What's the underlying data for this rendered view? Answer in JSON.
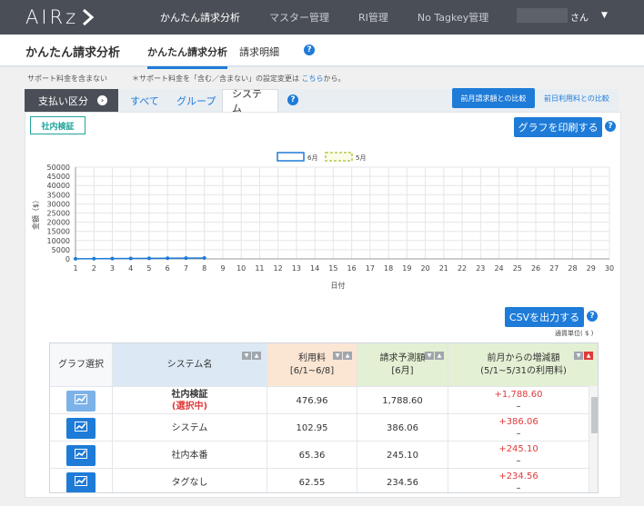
{
  "app": {
    "logo": "AIRz",
    "nav": [
      "かんたん請求分析",
      "マスター管理",
      "RI管理",
      "No Tagkey管理"
    ],
    "user_suffix": "さん",
    "user_caret": "▼"
  },
  "header": {
    "title": "かんたん請求分析",
    "tabs": [
      "かんたん請求分析",
      "請求明細"
    ],
    "help": "?"
  },
  "notes": {
    "support": "サポート料金を含まない",
    "support_setting_prefix": "＊サポート料金を「含む／含まない」の設定変更は",
    "support_setting_link": "こちら",
    "support_setting_suffix": "から。"
  },
  "tabs": {
    "payment_category": "支払い区分",
    "items": [
      "すべて",
      "グループ",
      "システム"
    ],
    "compare_prev_month": "前月請求額との比較",
    "compare_prev_day": "前日利用料との比較"
  },
  "selected_system": "社内検証",
  "print_button": "グラフを印刷する",
  "csv_button": "CSVを出力する",
  "unit_note": "通貨単位( $ )",
  "chart_data": {
    "type": "line",
    "legend": [
      "6月",
      "5月"
    ],
    "xlabel": "日付",
    "ylabel": "金額（$）",
    "x": [
      1,
      2,
      3,
      4,
      5,
      6,
      7,
      8
    ],
    "xticks": [
      1,
      2,
      3,
      4,
      5,
      6,
      7,
      8,
      9,
      10,
      11,
      12,
      13,
      14,
      15,
      16,
      17,
      18,
      19,
      20,
      21,
      22,
      23,
      24,
      25,
      26,
      27,
      28,
      29,
      30
    ],
    "yticks": [
      0,
      5000,
      10000,
      15000,
      20000,
      25000,
      30000,
      35000,
      40000,
      45000,
      50000
    ],
    "ylim": [
      0,
      50000
    ],
    "series": [
      {
        "name": "6月",
        "values": [
          60,
          120,
          180,
          240,
          300,
          360,
          420,
          477
        ]
      },
      {
        "name": "5月",
        "values": []
      }
    ],
    "grid": true,
    "legend_position": "top-center",
    "colors": {
      "june": "#1e7bd8",
      "may": "#b8c94a"
    }
  },
  "table": {
    "headers": {
      "graph": "グラフ選択",
      "system": "システム名",
      "usage": [
        "利用料",
        "[6/1~6/8]"
      ],
      "forecast": [
        "請求予測額",
        "[6月]"
      ],
      "diff": [
        "前月からの増減額",
        "(5/1~5/31の利用料)"
      ]
    },
    "rows": [
      {
        "name": "社内検証",
        "sub": "(選択中)",
        "usage": "476.96",
        "forecast": "1,788.60",
        "diff": "+1,788.60",
        "diff2": "–"
      },
      {
        "name": "システム",
        "sub": "",
        "usage": "102.95",
        "forecast": "386.06",
        "diff": "+386.06",
        "diff2": "–"
      },
      {
        "name": "社内本番",
        "sub": "",
        "usage": "65.36",
        "forecast": "245.10",
        "diff": "+245.10",
        "diff2": "–"
      },
      {
        "name": "タグなし",
        "sub": "",
        "usage": "62.55",
        "forecast": "234.56",
        "diff": "+234.56",
        "diff2": "–"
      }
    ]
  }
}
